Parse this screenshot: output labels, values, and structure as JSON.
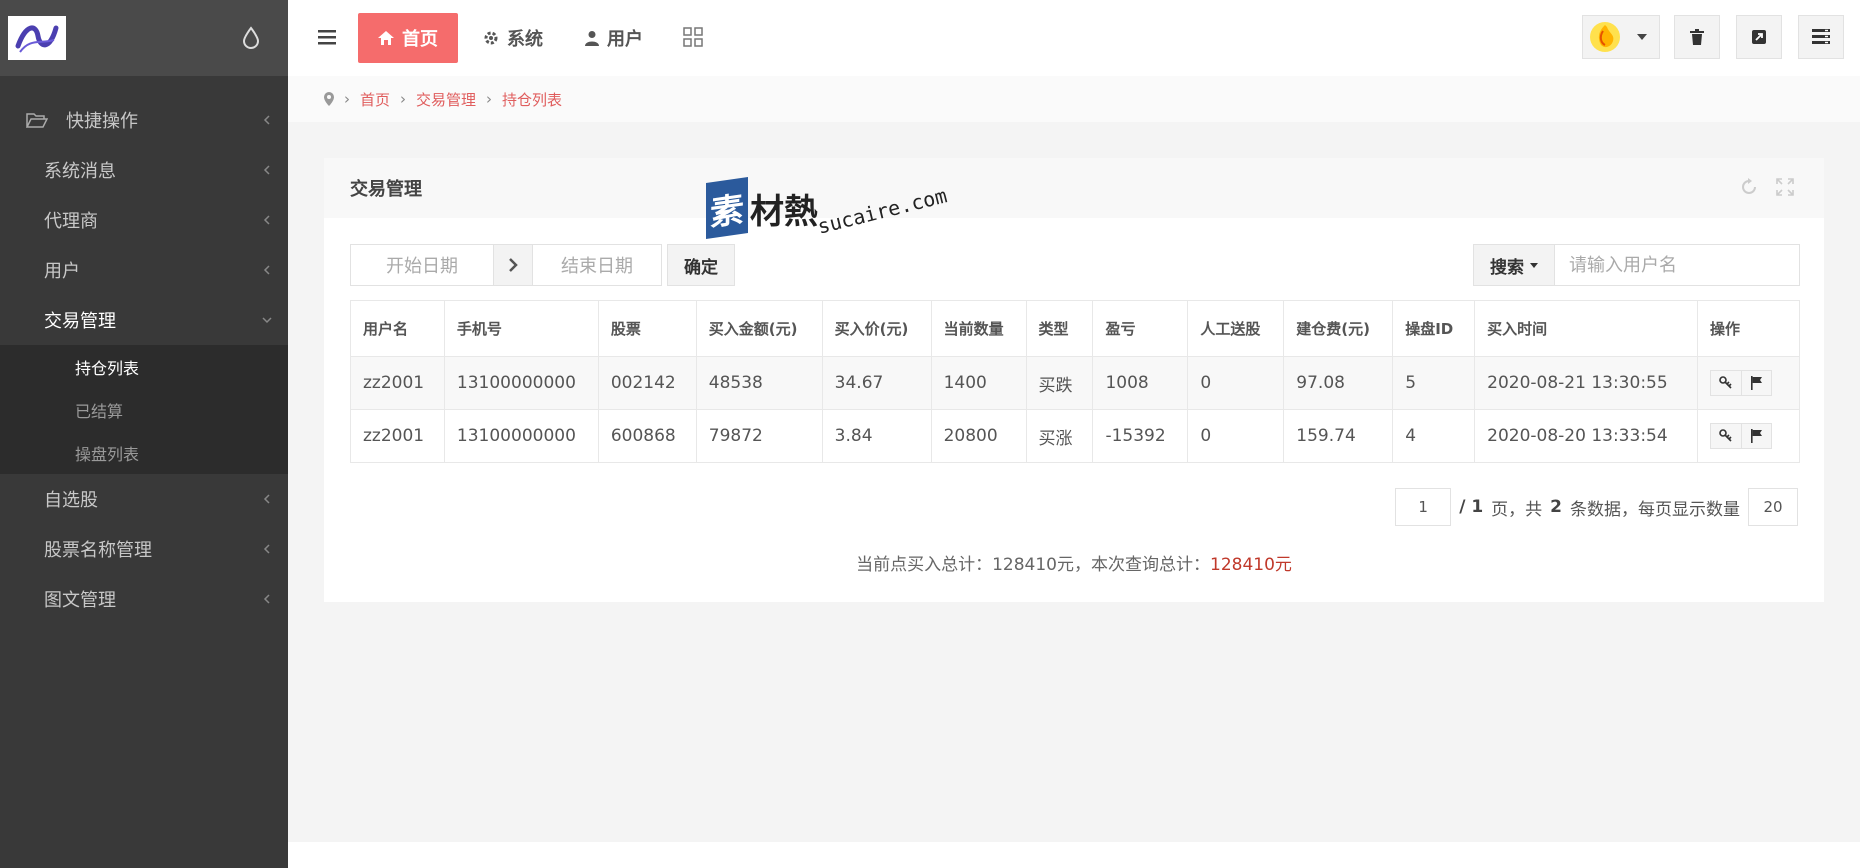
{
  "sidebar": {
    "items": [
      {
        "label": "快捷操作"
      },
      {
        "label": "系统消息"
      },
      {
        "label": "代理商"
      },
      {
        "label": "用户"
      },
      {
        "label": "交易管理"
      },
      {
        "label": "自选股"
      },
      {
        "label": "股票名称管理"
      },
      {
        "label": "图文管理"
      }
    ],
    "sub_items": [
      {
        "label": "持仓列表"
      },
      {
        "label": "已结算"
      },
      {
        "label": "操盘列表"
      }
    ]
  },
  "topnav": {
    "home": "首页",
    "system": "系统",
    "user": "用户"
  },
  "breadcrumb": [
    "首页",
    "交易管理",
    "持仓列表"
  ],
  "panel": {
    "title": "交易管理"
  },
  "watermark": {
    "cube": "素",
    "text": "材熱",
    "url": "sucaire.com"
  },
  "filters": {
    "start_date": "开始日期",
    "end_date": "结束日期",
    "confirm": "确定",
    "search": "搜索",
    "search_placeholder": "请输入用户名"
  },
  "table": {
    "headers": [
      "用户名",
      "手机号",
      "股票",
      "买入金额(元)",
      "买入价(元)",
      "当前数量",
      "类型",
      "盈亏",
      "人工送股",
      "建仓费(元)",
      "操盘ID",
      "买入时间",
      "操作"
    ],
    "rows": [
      [
        "zz2001",
        "13100000000",
        "002142",
        "48538",
        "34.67",
        "1400",
        "买跌",
        "1008",
        "0",
        "97.08",
        "5",
        "2020-08-21 13:30:55"
      ],
      [
        "zz2001",
        "13100000000",
        "600868",
        "79872",
        "3.84",
        "20800",
        "买涨",
        "-15392",
        "0",
        "159.74",
        "4",
        "2020-08-20 13:33:54"
      ]
    ]
  },
  "pager": {
    "page": "1",
    "total_pages": "/ 1",
    "page_unit": "页，共",
    "total_count": "2",
    "count_unit": "条数据，每页显示数量",
    "page_size": "20"
  },
  "totals": {
    "prefix": "当前点买入总计：128410元，本次查询总计：",
    "value": "128410元"
  }
}
